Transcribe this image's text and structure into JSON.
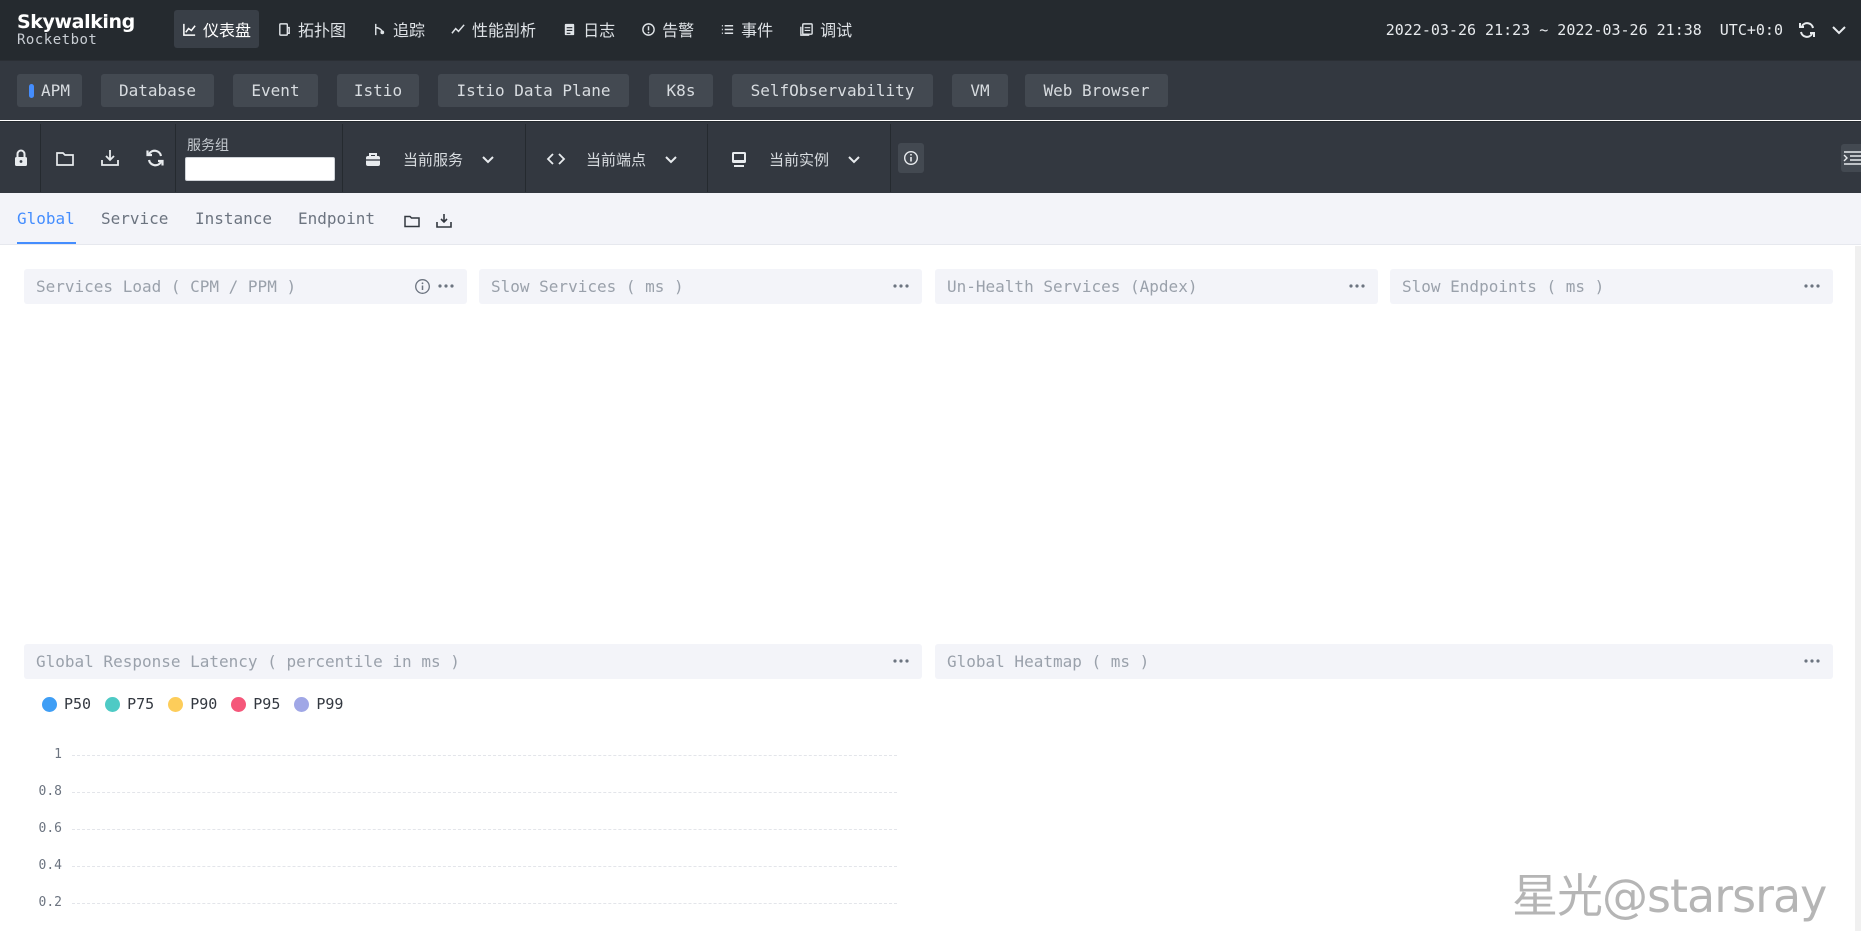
{
  "header": {
    "logo_main": "Skywalking",
    "logo_sub": "Rocketbot",
    "nav": [
      {
        "label": "仪表盘",
        "icon": "dashboard-icon"
      },
      {
        "label": "拓扑图",
        "icon": "topology-icon"
      },
      {
        "label": "追踪",
        "icon": "trace-icon"
      },
      {
        "label": "性能剖析",
        "icon": "profile-icon"
      },
      {
        "label": "日志",
        "icon": "log-icon"
      },
      {
        "label": "告警",
        "icon": "alarm-icon"
      },
      {
        "label": "事件",
        "icon": "event-icon"
      },
      {
        "label": "调试",
        "icon": "debug-icon"
      }
    ],
    "time_range": "2022-03-26 21:23 ~ 2022-03-26 21:38",
    "timezone": "UTC+0:0"
  },
  "layout_tabs": [
    "APM",
    "Database",
    "Event",
    "Istio",
    "Istio Data Plane",
    "K8s",
    "SelfObservability",
    "VM",
    "Web Browser"
  ],
  "toolbar": {
    "group_label": "服务组",
    "group_value": "",
    "service_label": "当前服务",
    "endpoint_label": "当前端点",
    "instance_label": "当前实例"
  },
  "sub_tabs": [
    "Global",
    "Service",
    "Instance",
    "Endpoint"
  ],
  "widgets": {
    "services_load": "Services Load ( CPM / PPM )",
    "slow_services": "Slow Services ( ms )",
    "unhealth_services": "Un-Health Services (Apdex)",
    "slow_endpoints": "Slow Endpoints ( ms )",
    "global_latency": "Global Response Latency ( percentile in ms )",
    "global_heatmap": "Global Heatmap ( ms )"
  },
  "chart_data": {
    "type": "line",
    "series": [
      {
        "name": "P50",
        "color": "#3f9ef5",
        "values": []
      },
      {
        "name": "P75",
        "color": "#4ecac5",
        "values": []
      },
      {
        "name": "P90",
        "color": "#fdcd5a",
        "values": []
      },
      {
        "name": "P95",
        "color": "#f5577a",
        "values": []
      },
      {
        "name": "P99",
        "color": "#a0a7e6",
        "values": []
      }
    ],
    "yticks": [
      "1",
      "0.8",
      "0.6",
      "0.4",
      "0.2"
    ],
    "ylim": [
      0,
      1
    ],
    "grid": true,
    "legend": "top-left"
  },
  "watermark": "星光@starsray"
}
